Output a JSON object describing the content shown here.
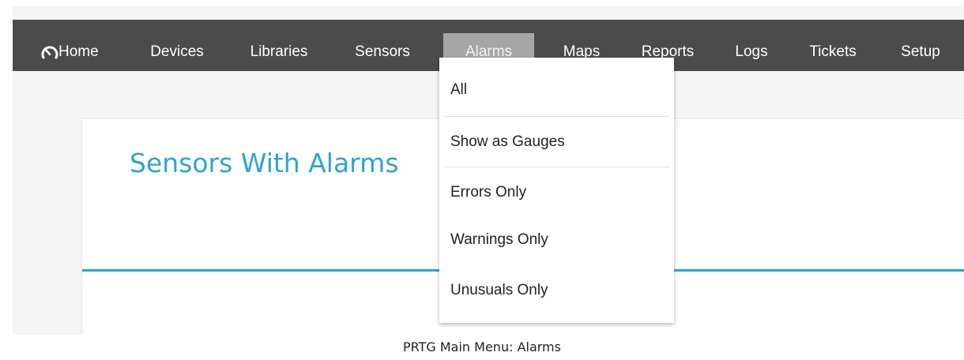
{
  "navbar": {
    "home_icon": "gauge-icon",
    "items": [
      {
        "label": "Home"
      },
      {
        "label": "Devices"
      },
      {
        "label": "Libraries"
      },
      {
        "label": "Sensors"
      },
      {
        "label": "Alarms",
        "active": true
      },
      {
        "label": "Maps"
      },
      {
        "label": "Reports"
      },
      {
        "label": "Logs"
      },
      {
        "label": "Tickets"
      },
      {
        "label": "Setup"
      }
    ]
  },
  "alarms_menu": {
    "items": [
      {
        "label": "All"
      },
      {
        "label": "Show as Gauges"
      },
      {
        "label": "Errors Only"
      },
      {
        "label": "Warnings Only"
      },
      {
        "label": "Unusuals Only"
      }
    ]
  },
  "page": {
    "title": "Sensors With Alarms"
  },
  "caption": "PRTG Main Menu: Alarms",
  "colors": {
    "navbar_bg": "#4b4b4b",
    "active_tab_bg": "#a6a6a6",
    "title_color": "#2ea3d5",
    "accent_line": "#29a3d4"
  }
}
